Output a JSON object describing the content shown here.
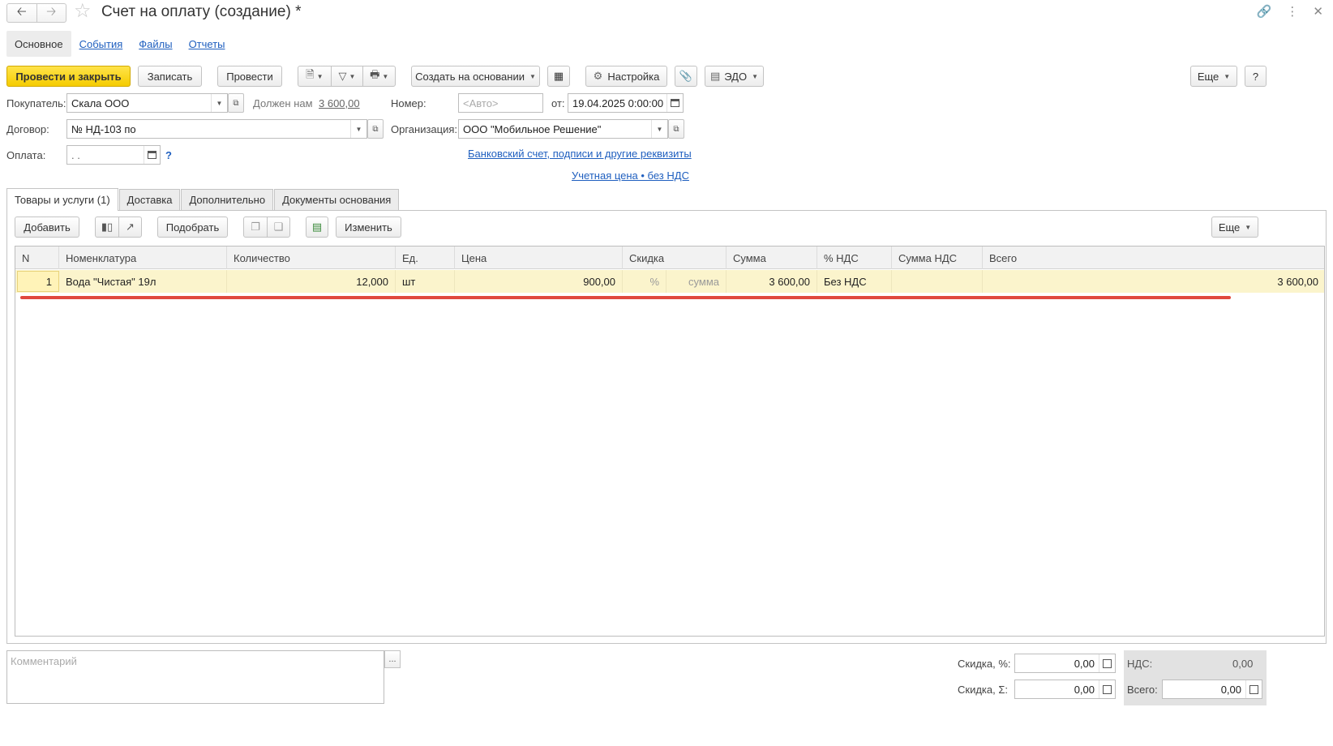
{
  "window": {
    "title": "Счет на оплату (создание) *",
    "back_icon": "arrow-left-icon",
    "forward_icon": "arrow-right-icon"
  },
  "top_tabs": [
    {
      "label": "Основное",
      "active": true
    },
    {
      "label": "События",
      "active": false
    },
    {
      "label": "Файлы",
      "active": false
    },
    {
      "label": "Отчеты",
      "active": false
    }
  ],
  "toolbar": {
    "post_and_close": "Провести и закрыть",
    "save": "Записать",
    "post": "Провести",
    "create_based_on": "Создать на основании",
    "settings": "Настройка",
    "edo": "ЭДО",
    "more": "Еще",
    "help": "?"
  },
  "header": {
    "buyer_label": "Покупатель:",
    "buyer_value": "Скала ООО",
    "owes_label": "Должен нам",
    "owes_amount": "3 600,00",
    "number_label": "Номер:",
    "number_placeholder": "<Авто>",
    "date_label": "от:",
    "date_value": "19.04.2025  0:00:00",
    "contract_label": "Договор:",
    "contract_value": "№ НД-103 по",
    "org_label": "Организация:",
    "org_value": "ООО \"Мобильное Решение\"",
    "payment_label": "Оплата:",
    "payment_value": " .  .",
    "help_mark": "?",
    "bank_link": "Банковский счет, подписи и другие реквизиты",
    "price_link": "Учетная цена • без НДС"
  },
  "doc_tabs": [
    {
      "label": "Товары и услуги (1)",
      "active": true
    },
    {
      "label": "Доставка",
      "active": false
    },
    {
      "label": "Дополнительно",
      "active": false
    },
    {
      "label": "Документы основания",
      "active": false
    }
  ],
  "table_toolbar": {
    "add": "Добавить",
    "pick": "Подобрать",
    "change": "Изменить",
    "more": "Еще"
  },
  "table": {
    "columns": [
      "N",
      "Номенклатура",
      "Количество",
      "Ед.",
      "Цена",
      "Скидка",
      "Сумма",
      "% НДС",
      "Сумма НДС",
      "Всего"
    ],
    "rows": [
      {
        "n": "1",
        "item": "Вода \"Чистая\" 19л",
        "qty": "12,000",
        "unit": "шт",
        "price": "900,00",
        "discount_pct": "%",
        "discount_sum": "сумма",
        "sum": "3 600,00",
        "vat_rate": "Без НДС",
        "vat_sum": "",
        "total": "3 600,00"
      }
    ]
  },
  "footer": {
    "comment_placeholder": "Комментарий",
    "comment_button": "...",
    "discount_pct_label": "Скидка, %:",
    "discount_pct_value": "0,00",
    "discount_sum_label": "Скидка, Σ:",
    "discount_sum_value": "0,00",
    "vat_label": "НДС:",
    "vat_value": "0,00",
    "total_label": "Всего:",
    "total_value": "0,00"
  },
  "colors": {
    "accent_yellow": "#f5cc00",
    "link_blue": "#1f5fbf",
    "row_highlight": "#fbf4cc",
    "annotation_red": "#e0483e"
  }
}
